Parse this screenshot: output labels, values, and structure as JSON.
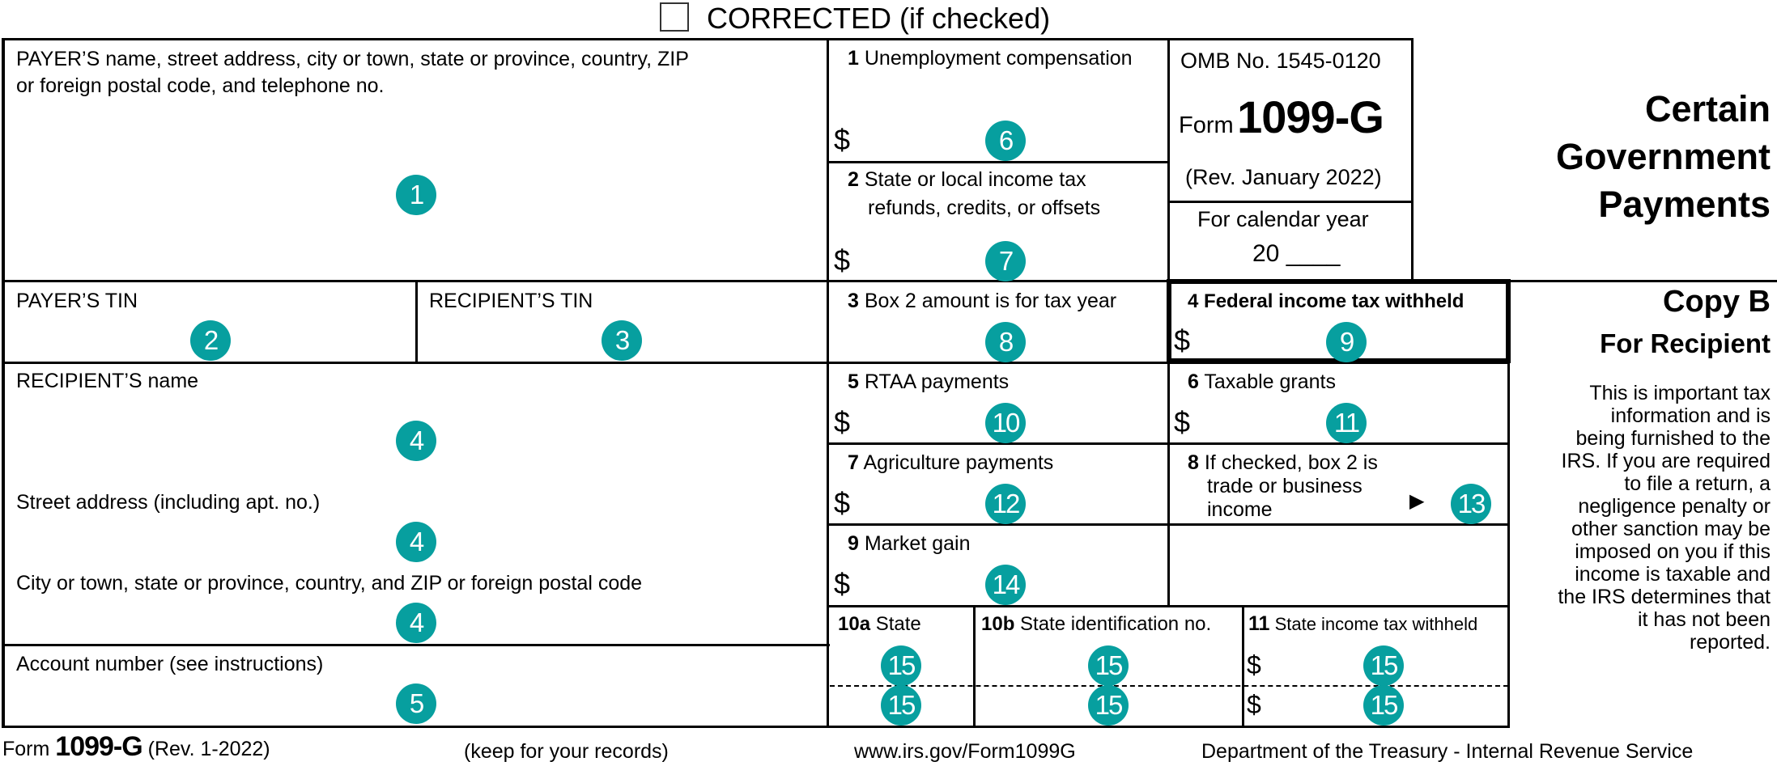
{
  "header": {
    "corrected_label": "CORRECTED (if checked)",
    "corrected_checked": false
  },
  "payer": {
    "name_label_line1": "PAYER’S name, street address, city or town, state or province, country, ZIP",
    "name_label_line2": "or foreign postal code, and telephone no.",
    "name_marker": "1",
    "tin_label": "PAYER’S TIN",
    "tin_marker": "2"
  },
  "recipient": {
    "tin_label": "RECIPIENT’S TIN",
    "tin_marker": "3",
    "name_label": "RECIPIENT’S name",
    "name_marker": "4",
    "street_label": "Street address (including apt. no.)",
    "street_marker": "4",
    "city_label": "City or town, state or province, country, and ZIP or foreign postal code",
    "city_marker": "4",
    "account_label": "Account number (see instructions)",
    "account_marker": "5"
  },
  "boxes": {
    "box1": {
      "num": "1",
      "label": "Unemployment compensation",
      "currency": "$",
      "marker": "6"
    },
    "box2": {
      "num": "2",
      "label_line1": "State or local income tax",
      "label_line2": "refunds, credits, or offsets",
      "currency": "$",
      "marker": "7"
    },
    "box3": {
      "num": "3",
      "label": "Box 2 amount is for tax year",
      "marker": "8"
    },
    "box4": {
      "num": "4",
      "label": "Federal income tax withheld",
      "currency": "$",
      "marker": "9"
    },
    "box5": {
      "num": "5",
      "label": "RTAA payments",
      "currency": "$",
      "marker": "10"
    },
    "box6": {
      "num": "6",
      "label": "Taxable grants",
      "currency": "$",
      "marker": "11"
    },
    "box7": {
      "num": "7",
      "label": "Agriculture payments",
      "currency": "$",
      "marker": "12"
    },
    "box8": {
      "num": "8",
      "label_line1": "If checked, box 2 is",
      "label_line2": "trade or business",
      "label_line3": "income",
      "arrow": "▶",
      "marker": "13"
    },
    "box9": {
      "num": "9",
      "label": "Market gain",
      "currency": "$",
      "marker": "14"
    },
    "box10a": {
      "num": "10a",
      "label": "State",
      "markers": [
        "15",
        "15"
      ]
    },
    "box10b": {
      "num": "10b",
      "label": "State identification no.",
      "markers": [
        "15",
        "15"
      ]
    },
    "box11": {
      "num": "11",
      "label": "State income tax withheld",
      "currency": "$",
      "markers": [
        "15",
        "15"
      ]
    }
  },
  "form_id": {
    "omb": "OMB No. 1545-0120",
    "form_word": "Form",
    "form_number": "1099-G",
    "revision": "(Rev. January 2022)",
    "calendar_label": "For calendar year",
    "calendar_prefix": "20",
    "calendar_blank": "____"
  },
  "title": {
    "line1": "Certain",
    "line2": "Government",
    "line3": "Payments"
  },
  "copy": {
    "title": "Copy B",
    "subtitle": "For Recipient",
    "notice_lines": [
      "This is important tax",
      "information and is",
      "being furnished to the",
      "IRS. If you are required",
      "to file a return, a",
      "negligence penalty or",
      "other sanction may be",
      "imposed on you if this",
      "income is taxable and",
      "the IRS determines that",
      "it has not been",
      "reported."
    ]
  },
  "footer": {
    "form_word": "Form",
    "form_number": "1099-G",
    "revision": "(Rev. 1-2022)",
    "keep": "(keep for your records)",
    "url": "www.irs.gov/Form1099G",
    "department": "Department of the Treasury - Internal Revenue Service"
  },
  "colors": {
    "marker_bg": "#079f9f",
    "marker_text": "#ffffff",
    "rule": "#000000"
  }
}
